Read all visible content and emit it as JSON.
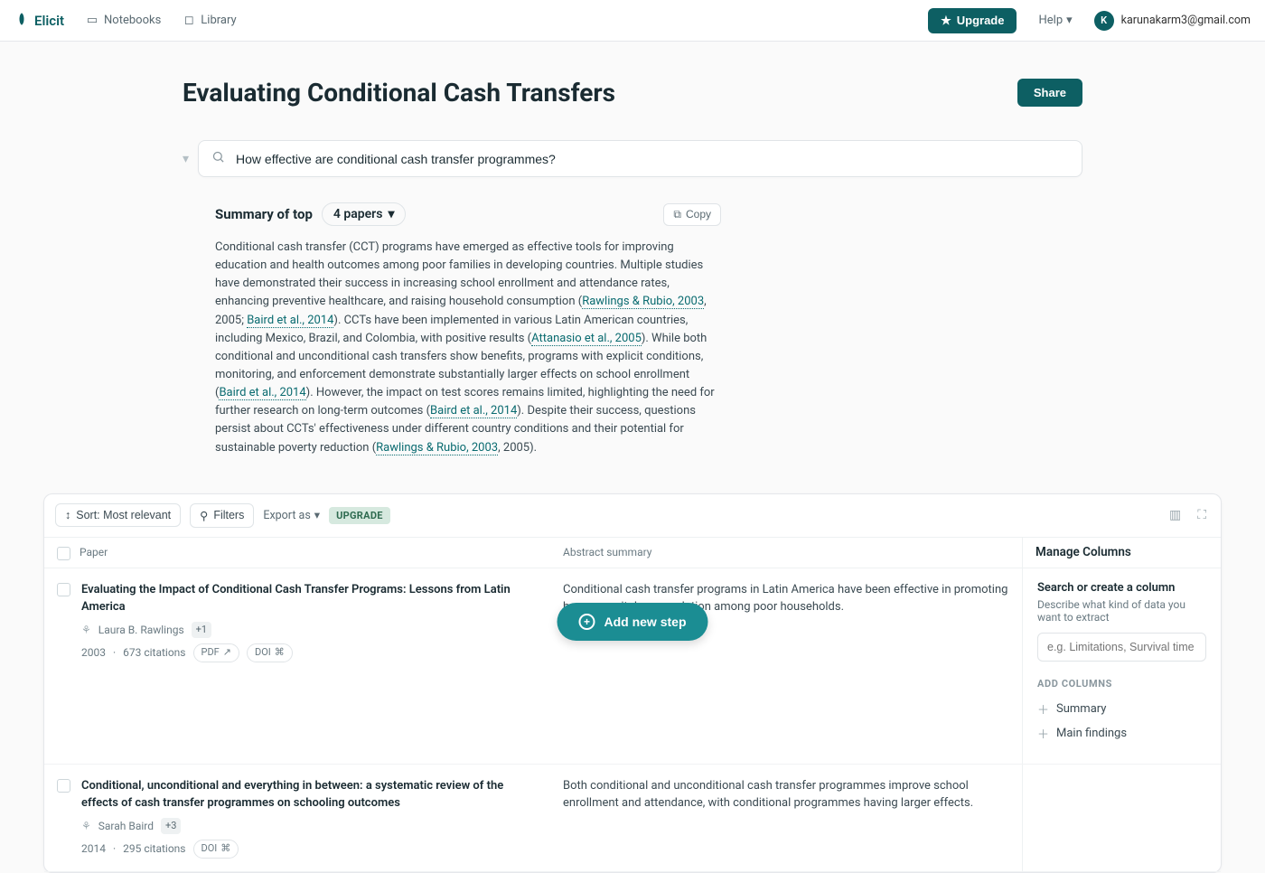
{
  "topbar": {
    "brand": "Elicit",
    "notebooks": "Notebooks",
    "library": "Library",
    "upgrade": "Upgrade",
    "help": "Help",
    "avatar_letter": "K",
    "email": "karunakarm3@gmail.com"
  },
  "page": {
    "title": "Evaluating Conditional Cash Transfers",
    "share": "Share"
  },
  "search": {
    "value": "How effective are conditional cash transfer programmes?"
  },
  "summary": {
    "label": "Summary of top",
    "papers_pill": "4 papers",
    "copy": "Copy",
    "t1": "Conditional cash transfer (CCT) programs have emerged as effective tools for improving education and health outcomes among poor families in developing countries. Multiple studies have demonstrated their success in increasing school enrollment and attendance rates, enhancing preventive healthcare, and raising household consumption (",
    "c1": "Rawlings & Rubio, 2003",
    "t2": ", 2005; ",
    "c2": "Baird et al., 2014",
    "t3": "). CCTs have been implemented in various Latin American countries, including Mexico, Brazil, and Colombia, with positive results (",
    "c3": "Attanasio et al., 2005",
    "t4": "). While both conditional and unconditional cash transfers show benefits, programs with explicit conditions, monitoring, and enforcement demonstrate substantially larger effects on school enrollment (",
    "c4": "Baird et al., 2014",
    "t5": "). However, the impact on test scores remains limited, highlighting the need for further research on long-term outcomes (",
    "c5": "Baird et al., 2014",
    "t6": "). Despite their success, questions persist about CCTs' effectiveness under different country conditions and their potential for sustainable poverty reduction (",
    "c6": "Rawlings & Rubio, 2003",
    "t7": ", 2005)."
  },
  "toolbar": {
    "sort": "Sort: Most relevant",
    "filters": "Filters",
    "export": "Export as",
    "upgrade_badge": "UPGRADE"
  },
  "columns": {
    "paper": "Paper",
    "abstract": "Abstract summary",
    "manage": "Manage Columns"
  },
  "papers": [
    {
      "title": "Evaluating the Impact of Conditional Cash Transfer Programs: Lessons from Latin America",
      "author": "Laura B. Rawlings",
      "plus": "+1",
      "year": "2003",
      "citations": "673 citations",
      "pdf": "PDF",
      "doi": "DOI",
      "abstract": "Conditional cash transfer programs in Latin America have been effective in promoting human capital accumulation among poor households."
    },
    {
      "title": "Conditional, unconditional and everything in between: a systematic review of the effects of cash transfer programmes on schooling outcomes",
      "author": "Sarah Baird",
      "plus": "+3",
      "year": "2014",
      "citations": "295 citations",
      "pdf": "",
      "doi": "DOI",
      "abstract": "Both conditional and unconditional cash transfer programmes improve school enrollment and attendance, with conditional programmes having larger effects."
    }
  ],
  "side": {
    "search_title": "Search or create a column",
    "search_desc": "Describe what kind of data you want to extract",
    "placeholder": "e.g. Limitations, Survival time",
    "section": "ADD COLUMNS",
    "items": [
      "Summary",
      "Main findings"
    ]
  },
  "fab": "Add new step"
}
